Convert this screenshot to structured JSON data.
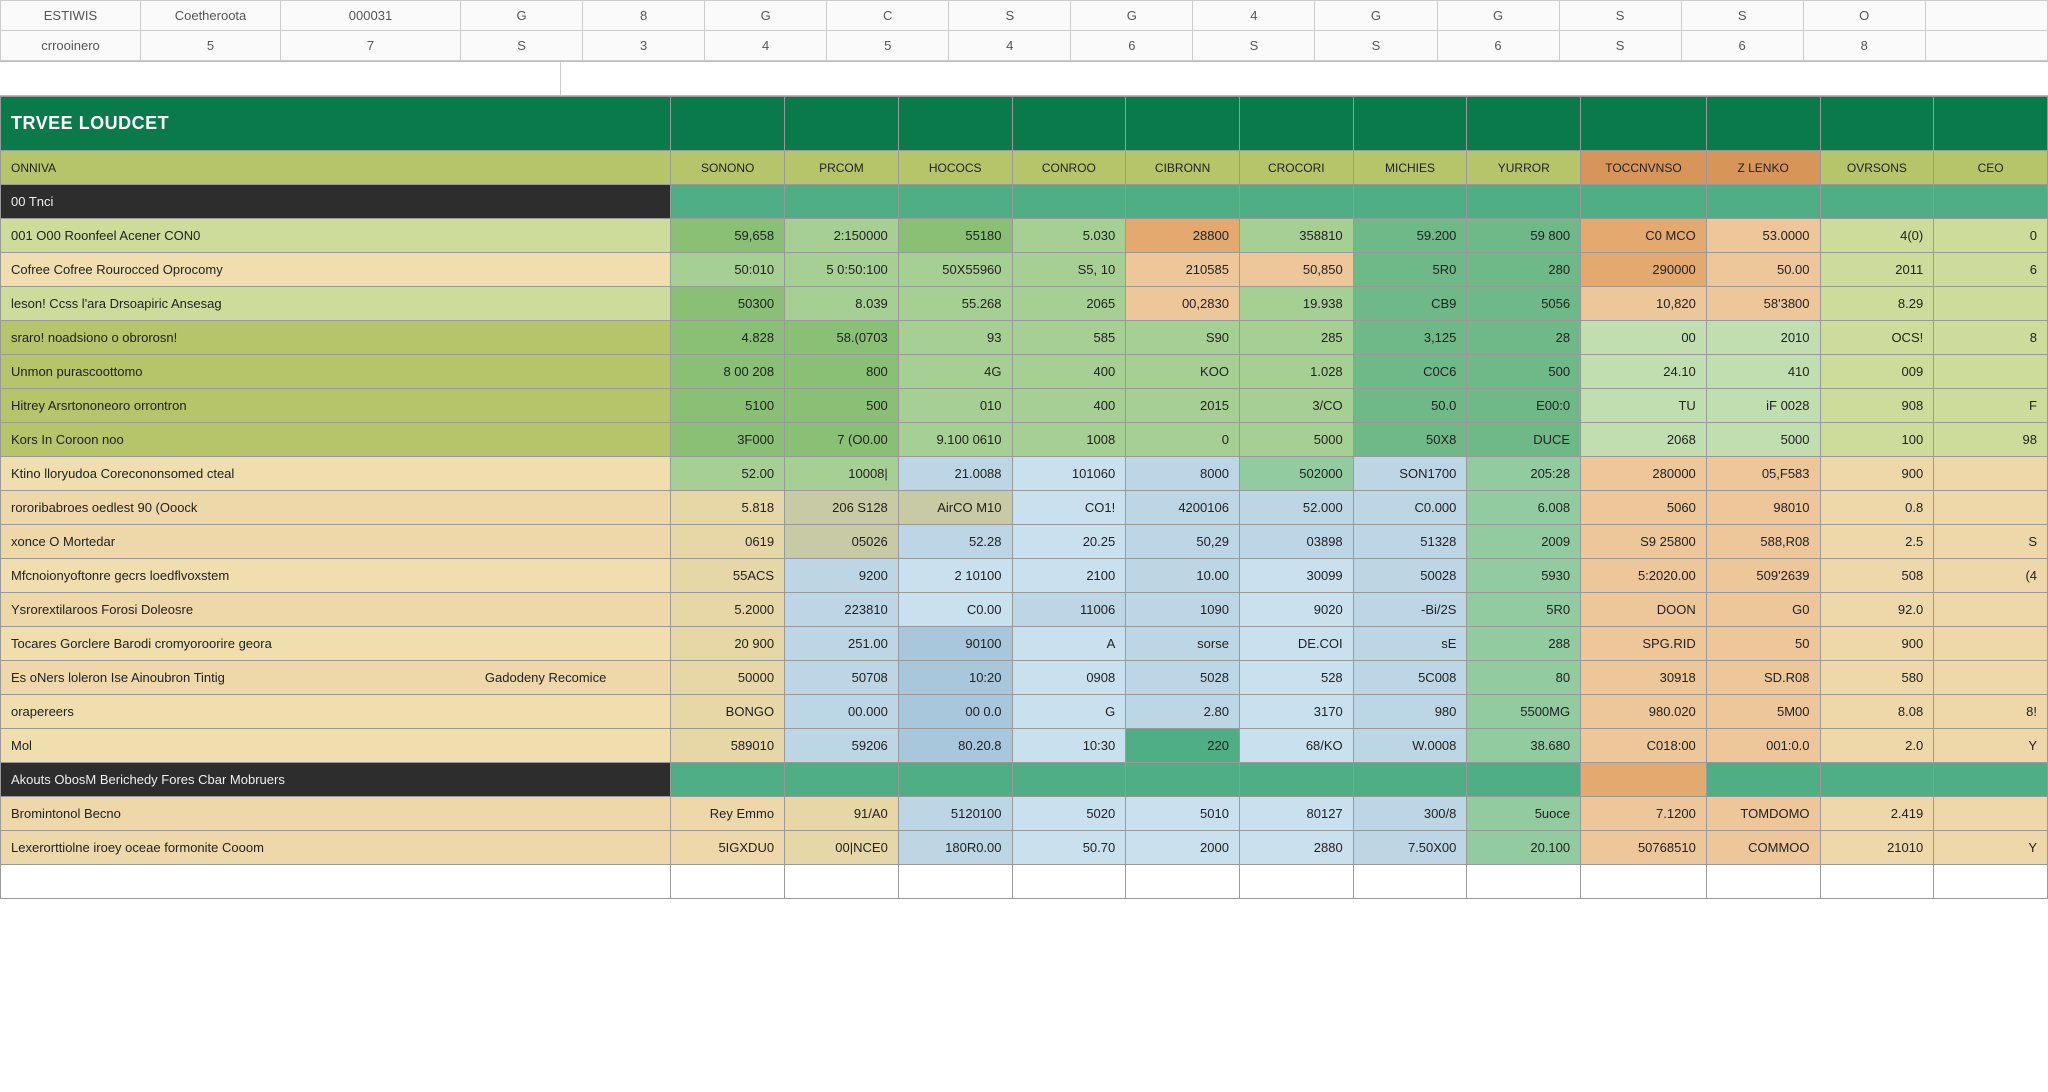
{
  "topbar": {
    "row1": [
      "ESTIWIS",
      "Coetheroota",
      "000031",
      "G",
      "8",
      "G",
      "C",
      "S",
      "G",
      "4",
      "G",
      "G",
      "S",
      "S",
      "O",
      ""
    ],
    "row2": [
      "crrooinero",
      "5",
      "7",
      "S",
      "3",
      "4",
      "5",
      "4",
      "6",
      "S",
      "S",
      "6",
      "S",
      "6",
      "8",
      ""
    ]
  },
  "budget": {
    "title": "TRVEE LOUDCET",
    "col_headers": [
      "SONONO",
      "PRCOM",
      "HOCOCS",
      "CONROO",
      "CIBRONN",
      "CROCORI",
      "MICHIES",
      "YURROR",
      "TOCCNVNSO",
      "Z LENKO",
      "OVRSONS",
      "CEO"
    ],
    "sections": [
      {
        "type": "section",
        "label": "00 Tnci"
      },
      {
        "label": "001 O00 Roonfeel Acener CON0",
        "tone": "lime",
        "cells": [
          "59,658",
          "2:150000",
          "55180",
          "5.030",
          "28800",
          "358810",
          "59.200",
          "59 800",
          "C0 MCO",
          "53.0000",
          "4(0)",
          "0"
        ],
        "palette": [
          "green1",
          "green2",
          "green1",
          "green2",
          "orange1",
          "green2",
          "greenA",
          "greenA",
          "orange1",
          "orange2",
          "lime",
          "lime"
        ]
      },
      {
        "label": "Cofree Cofree Rourocced Oprocomy",
        "tone": "yellow",
        "cells": [
          "50:010",
          "5 0:50:100",
          "50X55960",
          "S5, 10",
          "210585",
          "50,850",
          "5R0",
          "280",
          "290000",
          "50.00",
          "2011",
          "6"
        ],
        "palette": [
          "green2",
          "green2",
          "green2",
          "green2",
          "orange2",
          "orange2",
          "greenA",
          "greenA",
          "orange1",
          "orange2",
          "lime",
          "lime"
        ]
      },
      {
        "label": "leson! Ccss l'ara Drsoapiric Ansesag",
        "tone": "lime",
        "cells": [
          "50300",
          "8.039",
          "55.268",
          "2065",
          "00,2830",
          "19.938",
          "CB9",
          "5056",
          "10,820",
          "58'3800",
          "8.29",
          ""
        ],
        "palette": [
          "green1",
          "green2",
          "green2",
          "green2",
          "orange2",
          "green2",
          "greenA",
          "greenA",
          "orange2",
          "orange2",
          "lime",
          "lime"
        ]
      },
      {
        "label": "sraro! noadsiono o obrorosn!",
        "tone": "olive",
        "cells": [
          "4.828",
          "58.(0703",
          "93",
          "585",
          "S90",
          "285",
          "3,125",
          "28",
          "00",
          "2010",
          "OCS!",
          "8"
        ],
        "palette": [
          "green1",
          "green1",
          "green2",
          "green2",
          "green2",
          "green2",
          "greenA",
          "greenA",
          "green3",
          "green3",
          "lime",
          "lime"
        ]
      },
      {
        "label": "Unmon purascoottomo",
        "tone": "olive",
        "cells": [
          "8 00 208",
          "800",
          "4G",
          "400",
          "KOO",
          "1.028",
          "C0C6",
          "500",
          "24.10",
          "410",
          "009",
          ""
        ],
        "palette": [
          "green1",
          "green1",
          "green2",
          "green2",
          "green2",
          "green2",
          "greenA",
          "greenA",
          "green3",
          "green3",
          "lime",
          "lime"
        ]
      },
      {
        "label": "Hitrey Arsrtononeoro orrontron",
        "tone": "olive",
        "cells": [
          "5100",
          "500",
          "010",
          "400",
          "2015",
          "3/CO",
          "50.0",
          "E00:0",
          "TU",
          "iF 0028",
          "908",
          "F"
        ],
        "palette": [
          "green1",
          "green1",
          "green2",
          "green2",
          "green2",
          "green2",
          "greenA",
          "greenA",
          "green3",
          "green3",
          "lime",
          "lime"
        ]
      },
      {
        "label": "Kors In Coroon noo",
        "tone": "olive",
        "cells": [
          "3F000",
          "7 (O0.00",
          "9.100 0610",
          "1008",
          "0",
          "5000",
          "50X8",
          "DUCE",
          "2068",
          "5000",
          "100",
          "98"
        ],
        "palette": [
          "green1",
          "green1",
          "green2",
          "green2",
          "green2",
          "green2",
          "greenA",
          "greenA",
          "green3",
          "green3",
          "lime",
          "lime"
        ]
      },
      {
        "label": "Ktino lloryudoa Corecononsomed cteal",
        "tone": "yellow",
        "cells": [
          "52.00",
          "10008|",
          "21.0088",
          "101060",
          "8000",
          "502000",
          "SON1700",
          "205:28",
          "280000",
          "05,F583",
          "900",
          ""
        ],
        "palette": [
          "green2",
          "green2",
          "blue1",
          "blue3",
          "blue1",
          "greenB",
          "blue1",
          "greenB",
          "orange2",
          "orange2",
          "sand",
          "sand"
        ]
      },
      {
        "label": "rororibabroes oedlest 90 (Ooock",
        "tone": "sand",
        "cells": [
          "5.818",
          "206 S128",
          "AirCO M10",
          "CO1!",
          "4200106",
          "52.000",
          "C0.000",
          "6.008",
          "5060",
          "98010",
          "0.8",
          ""
        ],
        "palette": [
          "tan",
          "gray",
          "gray",
          "blue3",
          "blue1",
          "blue1",
          "blue1",
          "greenB",
          "orange2",
          "orange2",
          "sand",
          "sand"
        ]
      },
      {
        "label": "xonce O Mortedar",
        "tone": "sand",
        "cells": [
          "0619",
          "05026",
          "52.28",
          "20.25",
          "50,29",
          "03898",
          "51328",
          "2009",
          "S9 25800",
          "588,R08",
          "2.5",
          "S"
        ],
        "palette": [
          "tan",
          "gray",
          "blue1",
          "blue3",
          "blue1",
          "blue1",
          "blue1",
          "greenB",
          "orange2",
          "orange2",
          "sand",
          "sand"
        ]
      },
      {
        "label": "Mfcnoionyoftonre gecrs loedflvoxstem",
        "tone": "yellow",
        "cells": [
          "55ACS",
          "9200",
          "2 10100",
          "2100",
          "10.00",
          "30099",
          "50028",
          "5930",
          "5:2020.00",
          "509'2639",
          "508",
          "(4"
        ],
        "palette": [
          "tan",
          "blue1",
          "blue3",
          "blue3",
          "blue1",
          "blue3",
          "blue1",
          "greenB",
          "orange2",
          "orange2",
          "sand",
          "sand"
        ]
      },
      {
        "label": "Ysrorextilaroos Forosi Doleosre",
        "tone": "sand",
        "cells": [
          "5.2000",
          "223810",
          "C0.00",
          "11006",
          "1090",
          "9020",
          "-Bi/2S",
          "5R0",
          "DOON",
          "G0",
          "92.0",
          ""
        ],
        "palette": [
          "tan",
          "blue1",
          "blue3",
          "blue1",
          "blue1",
          "blue3",
          "blue1",
          "greenB",
          "orange2",
          "orange2",
          "sand",
          "sand"
        ]
      },
      {
        "label": "Tocares Gorclere Barodi cromyoroorire geora",
        "tone": "yellow",
        "cells": [
          "20 900",
          "251.00",
          "90100",
          "A",
          "sorse",
          "DE.COI",
          "sE",
          "288",
          "SPG.RID",
          "50",
          "900",
          ""
        ],
        "palette": [
          "tan",
          "blue1",
          "blue2",
          "blue3",
          "blue1",
          "blue3",
          "blue1",
          "greenB",
          "orange2",
          "orange2",
          "sand",
          "sand"
        ]
      },
      {
        "label": "Es oNers loleron Ise Ainoubron Tintig",
        "extra": "Gadodeny Recomice",
        "tone": "sand",
        "cells": [
          "50000",
          "50708",
          "10:20",
          "0908",
          "5028",
          "528",
          "5C008",
          "80",
          "30918",
          "SD.R08",
          "580",
          ""
        ],
        "palette": [
          "tan",
          "blue1",
          "blue2",
          "blue3",
          "blue1",
          "blue3",
          "blue1",
          "greenB",
          "orange2",
          "orange2",
          "sand",
          "sand"
        ]
      },
      {
        "label": "orapereers",
        "tone": "yellow",
        "cells": [
          "BONGO",
          "00.000",
          "00 0.0",
          "G",
          "2.80",
          "3170",
          "980",
          "5500MG",
          "980.020",
          "5M00",
          "8.08",
          "8!"
        ],
        "palette": [
          "tan",
          "blue1",
          "blue2",
          "blue3",
          "blue1",
          "blue3",
          "blue1",
          "greenB",
          "orange2",
          "orange2",
          "sand",
          "sand"
        ]
      },
      {
        "label": "Mol",
        "tone": "yellow",
        "cells": [
          "589010",
          "59206",
          "80.20.8",
          "10:30",
          "220",
          "68/KO",
          "W.0008",
          "38.680",
          "C018:00",
          "001:0.0",
          "2.0",
          "Y"
        ],
        "palette": [
          "tan",
          "blue1",
          "blue2",
          "blue3",
          "teal",
          "blue3",
          "blue1",
          "greenB",
          "orange2",
          "orange2",
          "sand",
          "sand"
        ]
      },
      {
        "type": "section",
        "label": "Akouts ObosM Berichedy Fores Cbar Mobruers",
        "palette": [
          "teal",
          "teal",
          "teal",
          "teal",
          "teal",
          "teal",
          "teal",
          "teal",
          "orange1",
          "teal",
          "teal",
          "teal"
        ]
      },
      {
        "label": "Bromintonol Becno",
        "tone": "sand",
        "cells": [
          "Rey Emmo",
          "91/A0",
          "5120100",
          "5020",
          "5010",
          "80127",
          "300/8",
          "5uoce",
          "7.1200",
          "TOMDOMO",
          "2.419",
          ""
        ],
        "palette": [
          "sand",
          "tan",
          "blue1",
          "blue3",
          "blue3",
          "blue3",
          "blue1",
          "greenB",
          "orange2",
          "orange2",
          "sand",
          "sand"
        ]
      },
      {
        "label": "Lexerorttiolne iroey oceae formonite Cooom",
        "tone": "sand",
        "cells": [
          "5IGXDU0",
          "00|NCE0",
          "180R0.00",
          "50.70",
          "2000",
          "2880",
          "7.50X00",
          "20.100",
          "50768510",
          "COMMOO",
          "21010",
          "Y"
        ],
        "palette": [
          "sand",
          "tan",
          "blue1",
          "blue3",
          "blue3",
          "blue3",
          "blue1",
          "greenB",
          "orange2",
          "orange2",
          "sand",
          "sand"
        ]
      }
    ]
  }
}
